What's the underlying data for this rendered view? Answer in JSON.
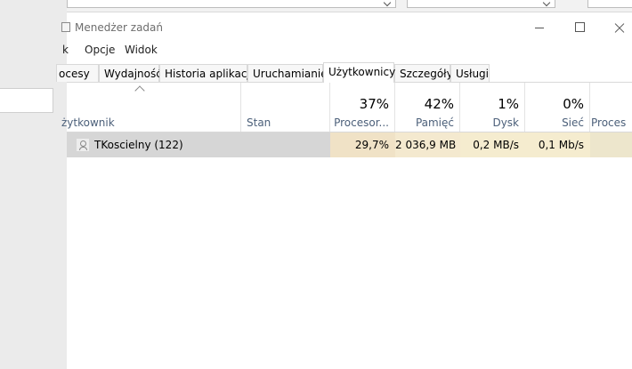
{
  "window": {
    "title": "Menedżer zadań"
  },
  "menu": {
    "file": "k",
    "options": "Opcje",
    "view": "Widok"
  },
  "tabs": [
    {
      "label": "ocesy"
    },
    {
      "label": "Wydajność"
    },
    {
      "label": "Historia aplikacji"
    },
    {
      "label": "Uruchamianie"
    },
    {
      "label": "Użytkownicy",
      "active": true
    },
    {
      "label": "Szczegóły"
    },
    {
      "label": "Usługi"
    }
  ],
  "columns": {
    "user": {
      "label": "żytkownik"
    },
    "status": {
      "label": "Stan"
    },
    "cpu": {
      "percent": "37%",
      "label": "Procesor..."
    },
    "memory": {
      "percent": "42%",
      "label": "Pamięć"
    },
    "disk": {
      "percent": "1%",
      "label": "Dysk"
    },
    "network": {
      "percent": "0%",
      "label": "Sieć"
    },
    "power": {
      "label": "Proces"
    }
  },
  "rows": [
    {
      "user": "TKoscielny (122)",
      "status": "",
      "cpu": "29,7%",
      "memory": "2 036,9 MB",
      "disk": "0,2 MB/s",
      "network": "0,1 Mb/s"
    }
  ],
  "colors": {
    "accent_header_text": "#4c607a",
    "selected_row": "#d6d6d6",
    "cpu_heat": "#f0e2c6",
    "mem_heat": "#f4e9cf"
  },
  "icons": [
    "app-icon",
    "minimize-icon",
    "maximize-icon",
    "close-icon",
    "sort-up-icon",
    "user-icon"
  ]
}
